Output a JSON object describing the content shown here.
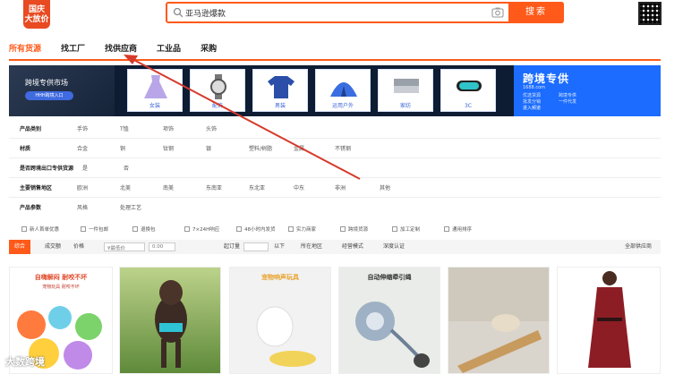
{
  "header": {
    "logo_line1": "国庆",
    "logo_line2": "大放价",
    "search_value": "亚马逊爆款",
    "search_button": "搜索"
  },
  "nav": {
    "tabs": [
      "所有货源",
      "找工厂",
      "找供应商",
      "工业品",
      "采购"
    ],
    "active_index": 0
  },
  "banner": {
    "left_title": "跨境专供市场",
    "left_pill": "HHH跨境入口",
    "categories": [
      "女装",
      "配饰",
      "男装",
      "运用户外",
      "家纺",
      "3C"
    ],
    "right_title": "跨境专供",
    "right_sub": "1688.com",
    "right_lines": [
      "优选货源",
      "跨境专供",
      "批发分销",
      "一件代发"
    ],
    "right_enter": "进入频道"
  },
  "filters": {
    "rows": [
      {
        "key": "产品类别",
        "values": [
          "手饰",
          "T恤",
          "项饰",
          "头饰"
        ]
      },
      {
        "key": "材质",
        "values": [
          "合金",
          "铜",
          "钛钢",
          "银",
          "塑料/树脂",
          "金属",
          "不锈钢"
        ]
      },
      {
        "key": "是否跨境出口专供货源",
        "values": [
          "是",
          "否"
        ]
      },
      {
        "key": "主要销售地区",
        "values": [
          "欧洲",
          "北美",
          "南美",
          "东南亚",
          "东北亚",
          "中东",
          "非洲",
          "其他"
        ]
      },
      {
        "key": "产品参数",
        "values": [
          "风格",
          "处理工艺"
        ]
      }
    ]
  },
  "options": [
    "新人首单优惠",
    "一件包邮",
    "退换包",
    "7×24H响应",
    "48小时内发货",
    "实力商家",
    "跨境货源",
    "加工定制",
    "通用排序"
  ],
  "sortbar": {
    "items": [
      "综合",
      "成交额",
      "价格",
      "¥最低价",
      "0.00",
      "起订量",
      "以下",
      "所在地区",
      "经营模式",
      "深度认证",
      "全部供应商"
    ]
  },
  "products": [
    {
      "title": "自嗨解闷 耐咬不坏",
      "subtitle": "宠物玩具 耐咬不坏"
    },
    {
      "title": "",
      "subtitle": ""
    },
    {
      "title": "宠物响声玩具",
      "subtitle": ""
    },
    {
      "title": "自动伸缩牵引绳",
      "subtitle": ""
    },
    {
      "title": "",
      "subtitle": ""
    },
    {
      "title": "",
      "subtitle": ""
    }
  ],
  "watermark": "大数跨境",
  "colors": {
    "accent": "#ff5a1a",
    "banner_dark": "#0e1c33",
    "banner_blue": "#1b6cff",
    "arrow": "#d63a2b"
  }
}
